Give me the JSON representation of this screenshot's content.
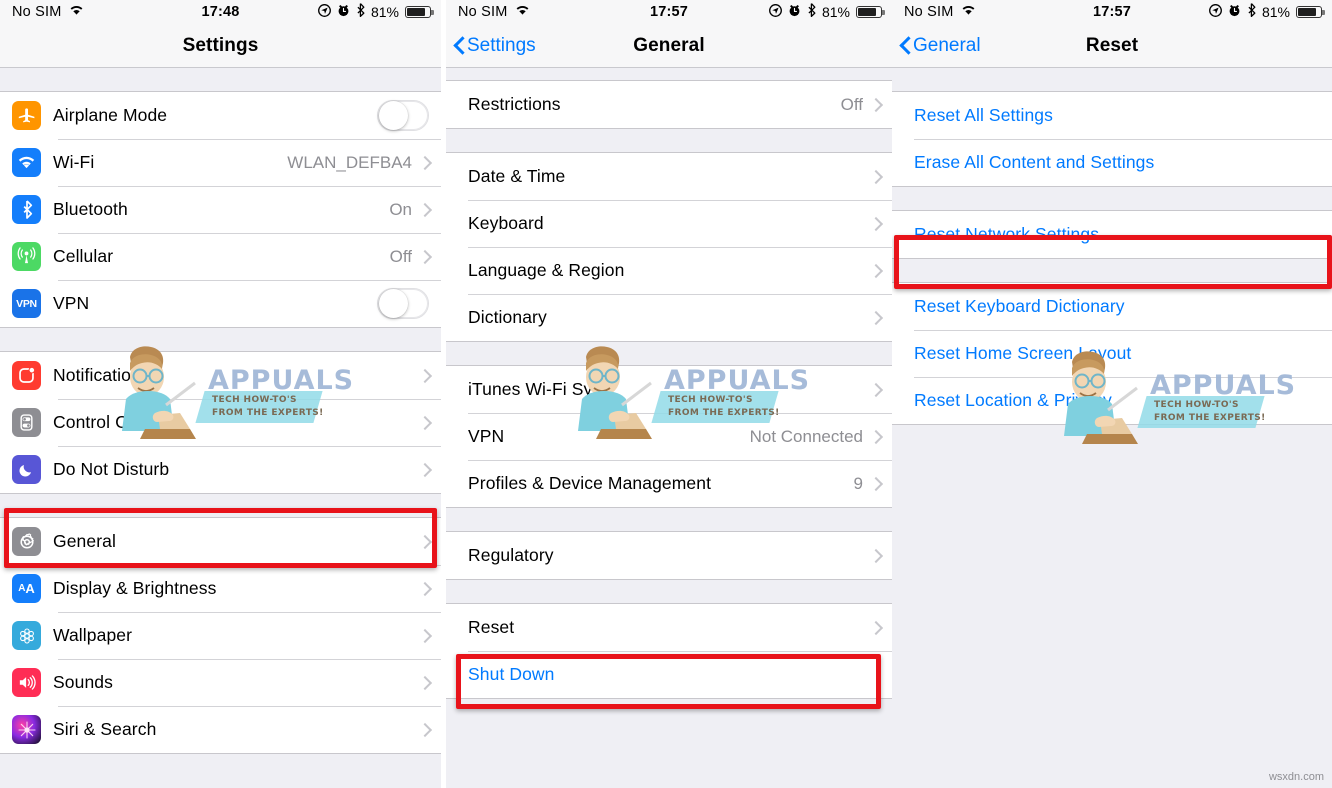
{
  "status_bar": {
    "carrier": "No SIM",
    "wifi_icon": "wifi-icon",
    "time_1": "17:48",
    "time_2": "17:57",
    "time_3": "17:57",
    "location_icon": "location-arrow-icon",
    "alarm_icon": "alarm-clock-icon",
    "bluetooth_icon": "bluetooth-icon",
    "battery_percent": "81%",
    "battery_icon": "battery-icon"
  },
  "watermark": {
    "brand": "APPUALS",
    "tagline": "TECH HOW-TO'S FROM THE EXPERTS!",
    "site": "wsxdn.com"
  },
  "highlight_color": "#e8131a",
  "accent_color": "#007aff",
  "panel1": {
    "title": "Settings",
    "groups": [
      {
        "rows": [
          {
            "icon": "airplane-icon",
            "label": "Airplane Mode",
            "control": "toggle",
            "value": ""
          },
          {
            "icon": "wifi-icon",
            "label": "Wi-Fi",
            "control": "chevron",
            "value": "WLAN_DEFBA4"
          },
          {
            "icon": "bluetooth-icon",
            "label": "Bluetooth",
            "control": "chevron",
            "value": "On"
          },
          {
            "icon": "cellular-icon",
            "label": "Cellular",
            "control": "chevron",
            "value": "Off"
          },
          {
            "icon": "vpn-icon",
            "label": "VPN",
            "control": "toggle",
            "value": ""
          }
        ]
      },
      {
        "rows": [
          {
            "icon": "notifications-icon",
            "label": "Notifications",
            "control": "chevron",
            "value": ""
          },
          {
            "icon": "control-center-icon",
            "label": "Control Center",
            "control": "chevron",
            "value": ""
          },
          {
            "icon": "do-not-disturb-icon",
            "label": "Do Not Disturb",
            "control": "chevron",
            "value": ""
          }
        ]
      },
      {
        "rows": [
          {
            "icon": "gear-icon",
            "label": "General",
            "control": "chevron",
            "value": "",
            "highlighted": true
          },
          {
            "icon": "display-brightness-icon",
            "label": "Display & Brightness",
            "control": "chevron",
            "value": ""
          },
          {
            "icon": "wallpaper-icon",
            "label": "Wallpaper",
            "control": "chevron",
            "value": ""
          },
          {
            "icon": "sounds-icon",
            "label": "Sounds",
            "control": "chevron",
            "value": ""
          },
          {
            "icon": "siri-search-icon",
            "label": "Siri & Search",
            "control": "chevron",
            "value": ""
          }
        ]
      }
    ]
  },
  "panel2": {
    "title": "General",
    "back_label": "Settings",
    "groups": [
      {
        "rows": [
          {
            "label": "Restrictions",
            "control": "chevron",
            "value": "Off"
          }
        ]
      },
      {
        "rows": [
          {
            "label": "Date & Time",
            "control": "chevron",
            "value": ""
          },
          {
            "label": "Keyboard",
            "control": "chevron",
            "value": ""
          },
          {
            "label": "Language & Region",
            "control": "chevron",
            "value": ""
          },
          {
            "label": "Dictionary",
            "control": "chevron",
            "value": ""
          }
        ]
      },
      {
        "rows": [
          {
            "label": "iTunes Wi-Fi Sync",
            "control": "chevron",
            "value": ""
          },
          {
            "label": "VPN",
            "control": "chevron",
            "value": "Not Connected"
          },
          {
            "label": "Profiles & Device Management",
            "control": "chevron",
            "value": "9"
          }
        ]
      },
      {
        "rows": [
          {
            "label": "Regulatory",
            "control": "chevron",
            "value": ""
          }
        ]
      },
      {
        "rows": [
          {
            "label": "Reset",
            "control": "chevron",
            "value": "",
            "highlighted": true
          },
          {
            "label": "Shut Down",
            "control": "none",
            "value": "",
            "blue": true
          }
        ]
      }
    ]
  },
  "panel3": {
    "title": "Reset",
    "back_label": "General",
    "groups": [
      {
        "rows": [
          {
            "label": "Reset All Settings",
            "control": "none",
            "value": "",
            "blue": true
          },
          {
            "label": "Erase All Content and Settings",
            "control": "none",
            "value": "",
            "blue": true
          }
        ]
      },
      {
        "rows": [
          {
            "label": "Reset Network Settings",
            "control": "none",
            "value": "",
            "blue": true,
            "highlighted": true
          }
        ]
      },
      {
        "rows": [
          {
            "label": "Reset Keyboard Dictionary",
            "control": "none",
            "value": "",
            "blue": true
          },
          {
            "label": "Reset Home Screen Layout",
            "control": "none",
            "value": "",
            "blue": true
          },
          {
            "label": "Reset Location & Privacy",
            "control": "none",
            "value": "",
            "blue": true
          }
        ]
      }
    ]
  }
}
